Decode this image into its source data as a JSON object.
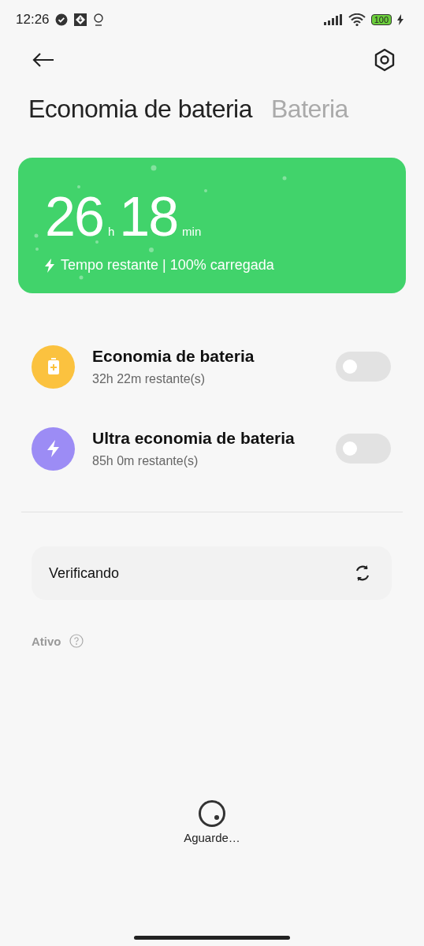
{
  "status_bar": {
    "time": "12:26",
    "battery": "100",
    "charging": true
  },
  "tabs": [
    {
      "label": "Economia de bateria",
      "selected": true
    },
    {
      "label": "Bateria",
      "selected": false
    }
  ],
  "summary": {
    "hours": "26",
    "hours_unit": "h",
    "minutes": "18",
    "minutes_unit": "min",
    "caption": "Tempo restante | 100% carregada"
  },
  "modes": [
    {
      "kind": "saver",
      "title": "Economia de bateria",
      "subtitle": "32h 22m restante(s)",
      "color": "#fbc23f",
      "on": false
    },
    {
      "kind": "ultra",
      "title": "Ultra economia de bateria",
      "subtitle": "85h 0m restante(s)",
      "color": "#9c8cf5",
      "on": false
    }
  ],
  "scan": {
    "label": "Verificando"
  },
  "section": {
    "label": "Ativo"
  },
  "loading": {
    "label": "Aguarde…"
  }
}
